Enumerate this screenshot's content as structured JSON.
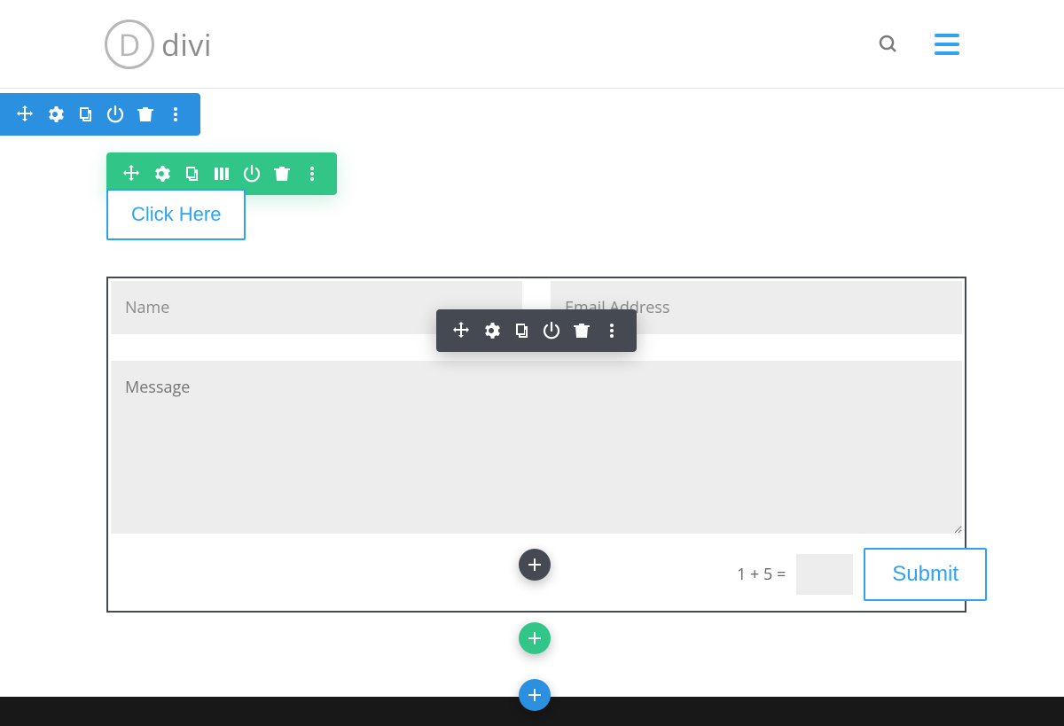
{
  "header": {
    "logo_letter": "D",
    "logo_text": "divi"
  },
  "button": {
    "click_here": "Click Here"
  },
  "form": {
    "name_placeholder": "Name",
    "email_placeholder": "Email Address",
    "message_placeholder": "Message",
    "captcha_question": "1 + 5 =",
    "submit_label": "Submit"
  }
}
